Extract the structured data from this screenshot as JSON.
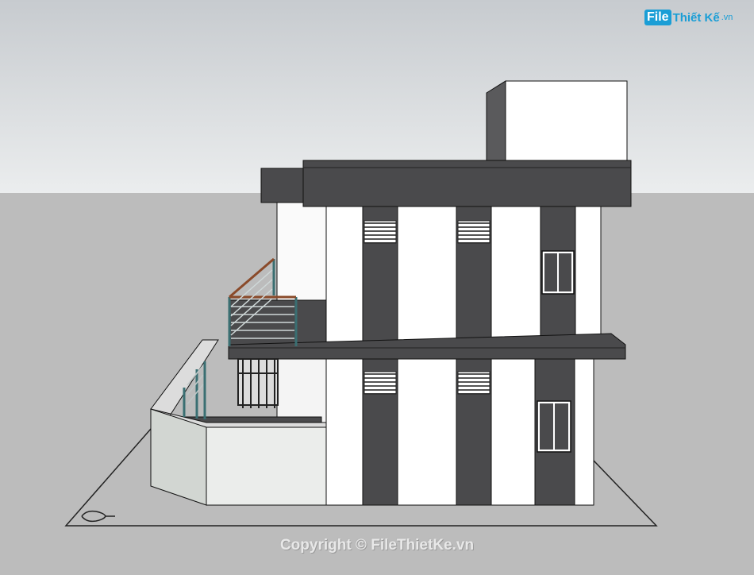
{
  "watermark": {
    "logo_badge": "File",
    "logo_name": "Thiết Kế",
    "logo_tld": ".vn",
    "copyright": "Copyright © FileThietKe.vn"
  },
  "colors": {
    "sky_top": "#c9cdd1",
    "sky_bottom": "#e9ebec",
    "ground": "#bdbdbd",
    "dark_panel": "#4a4a4c",
    "wall": "#ffffff",
    "railing": "#3a6f72"
  }
}
